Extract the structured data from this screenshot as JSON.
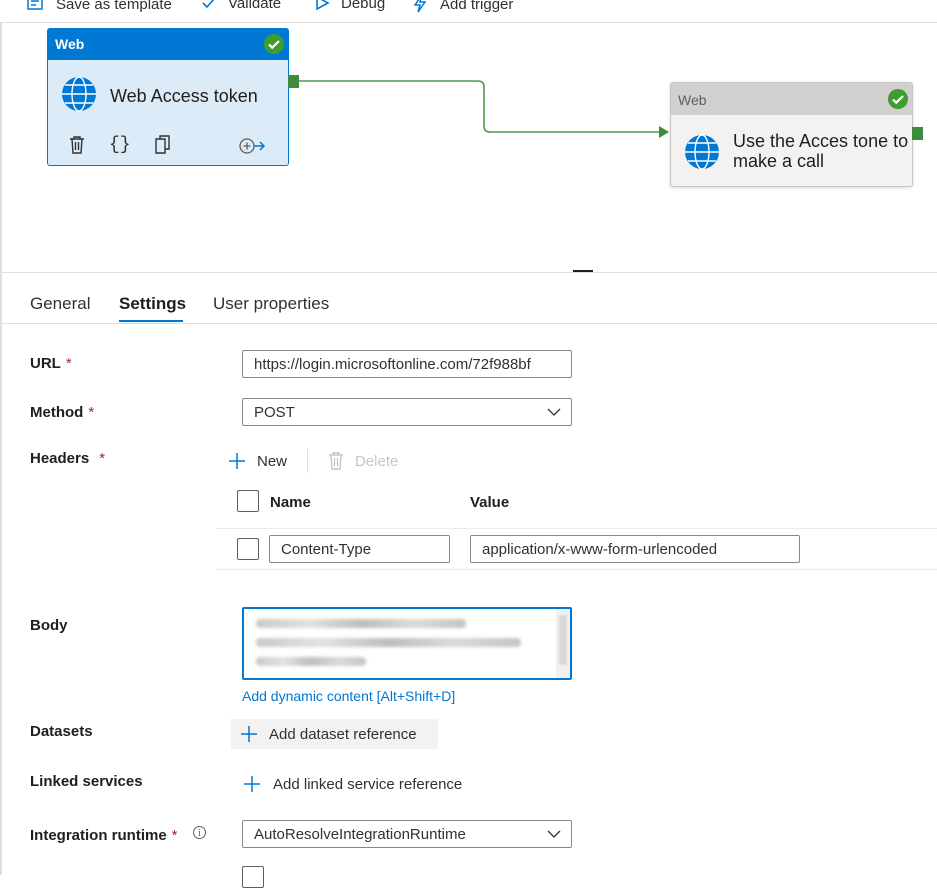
{
  "toolbar": {
    "save_template_label": "Save as template",
    "validate_label": "Validate",
    "debug_label": "Debug",
    "add_trigger_label": "Add trigger"
  },
  "pipeline": {
    "node1": {
      "type": "Web",
      "title": "Web Access token",
      "status": "succeeded"
    },
    "node2": {
      "type": "Web",
      "title_line1": "Use the Acces tone to",
      "title_line2": "make a call",
      "status": "succeeded"
    }
  },
  "tabs": [
    {
      "label": "General"
    },
    {
      "label": "Settings",
      "active": true
    },
    {
      "label": "User properties"
    }
  ],
  "settings": {
    "url": {
      "label": "URL",
      "required_mark": "*",
      "value": "https://login.microsoftonline.com/72f988bf"
    },
    "method": {
      "label": "Method",
      "required_mark": "*",
      "value": "POST"
    },
    "headers": {
      "label": "Headers",
      "required_mark": "*",
      "new_label": "New",
      "delete_label": "Delete",
      "col_name": "Name",
      "col_value": "Value",
      "rows": [
        {
          "name": "Content-Type",
          "value": "application/x-www-form-urlencoded"
        }
      ]
    },
    "body": {
      "label": "Body",
      "dynamic_link": "Add dynamic content [Alt+Shift+D]"
    },
    "datasets": {
      "label": "Datasets",
      "add_label": "Add dataset reference"
    },
    "linked_services": {
      "label": "Linked services",
      "add_label": "Add linked service reference"
    },
    "integration_runtime": {
      "label": "Integration runtime",
      "required_mark": "*",
      "info": "i",
      "value": "AutoResolveIntegrationRuntime"
    }
  },
  "colors": {
    "accent": "#0078d4",
    "success": "#3d9d2f",
    "required": "#a4262c"
  }
}
